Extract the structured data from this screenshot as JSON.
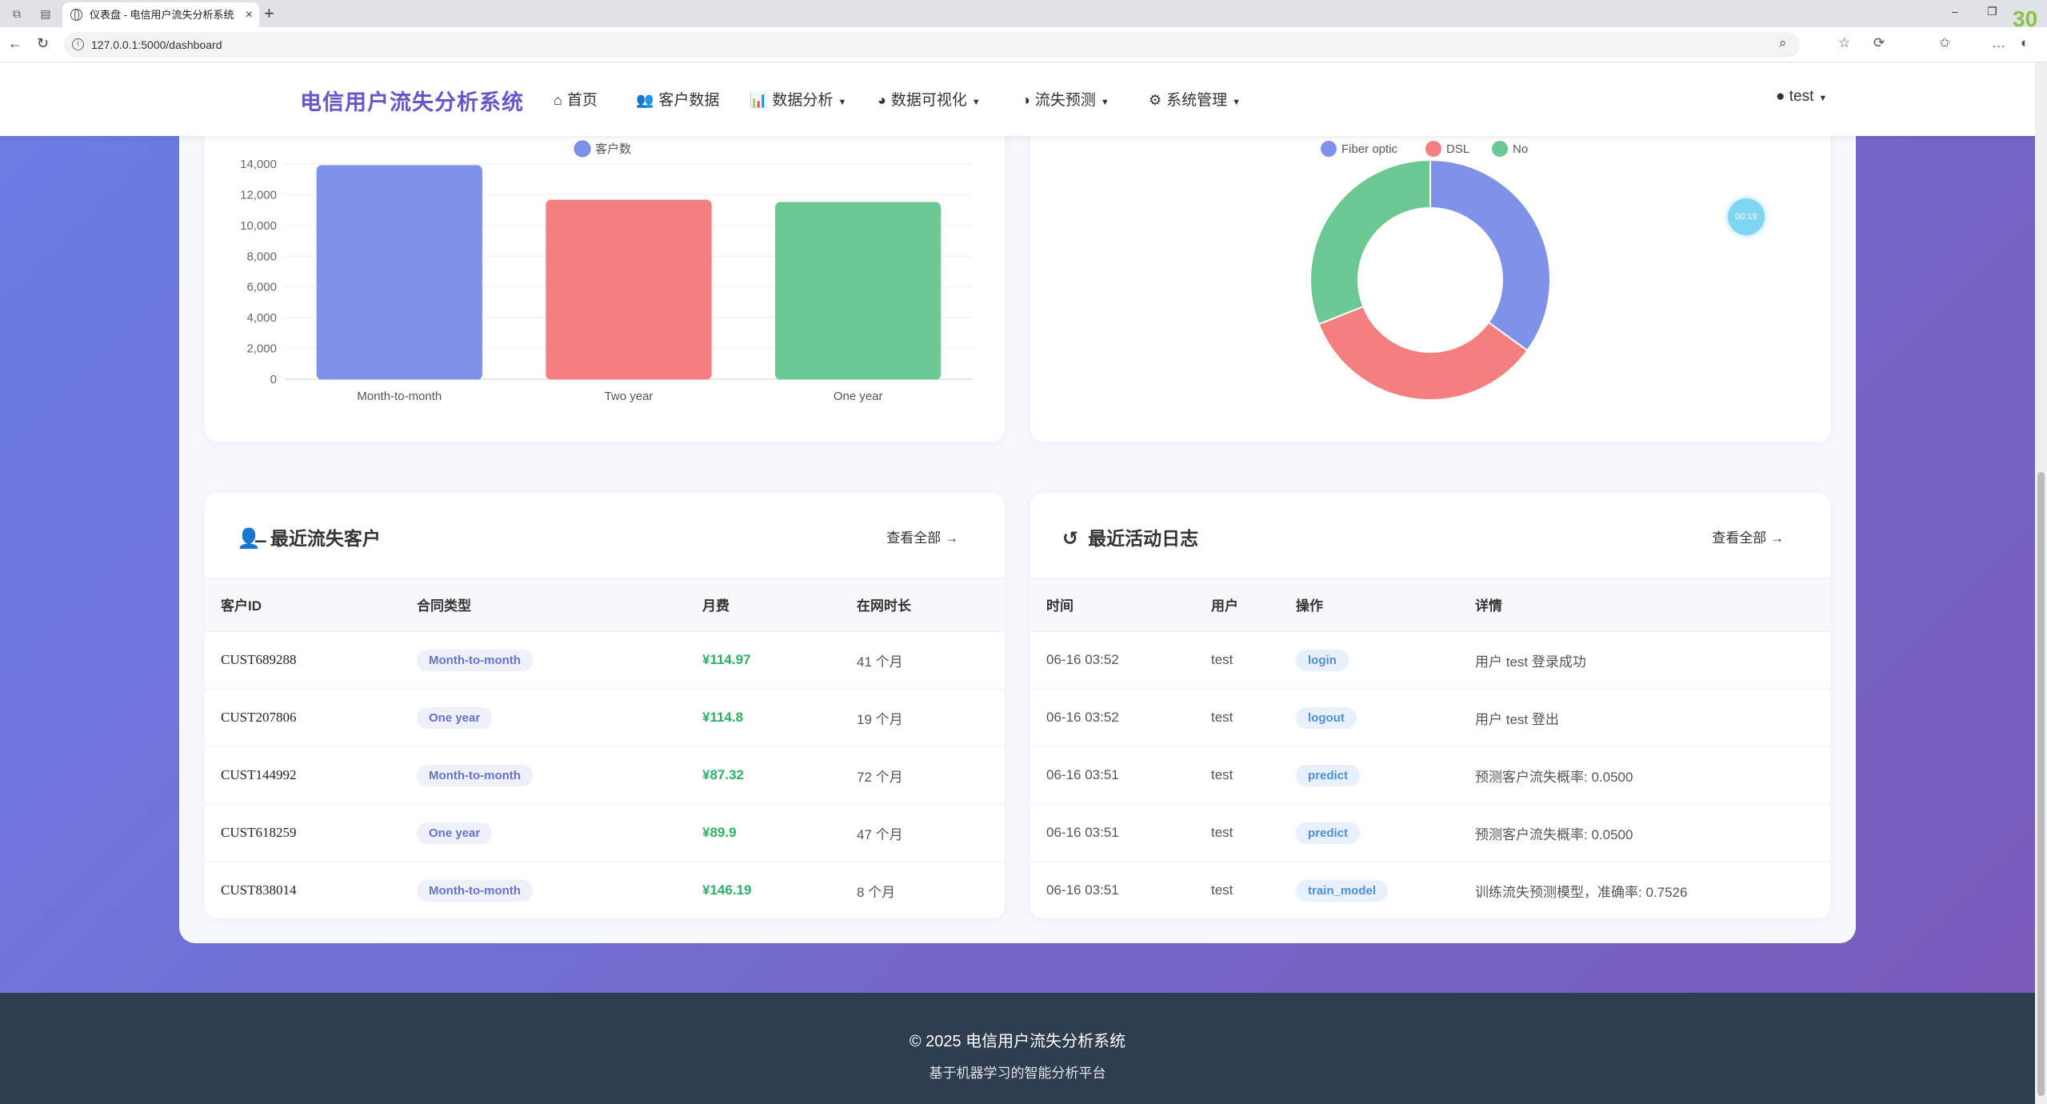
{
  "browser": {
    "tab_title": "仪表盘 - 电信用户流失分析系统",
    "url": "127.0.0.1:5000/dashboard",
    "corner_badge": "30"
  },
  "nav": {
    "brand": "电信用户流失分析系统",
    "items": [
      {
        "label": "首页",
        "icon": "home-icon"
      },
      {
        "label": "客户数据",
        "icon": "users-icon"
      },
      {
        "label": "数据分析",
        "icon": "chart-bar-icon"
      },
      {
        "label": "数据可视化",
        "icon": "pie-chart-icon"
      },
      {
        "label": "流失预测",
        "icon": "brain-icon"
      },
      {
        "label": "系统管理",
        "icon": "gear-icon"
      }
    ],
    "user": "test"
  },
  "timer": "00:19",
  "bar_chart": {
    "chart_data": {
      "type": "bar",
      "categories": [
        "Month-to-month",
        "Two year",
        "One year"
      ],
      "series": [
        {
          "name": "客户数",
          "values": [
            13900,
            11650,
            11500
          ]
        }
      ],
      "yticks": [
        "0",
        "2,000",
        "4,000",
        "6,000",
        "8,000",
        "10,000",
        "12,000",
        "14,000"
      ],
      "ylim": [
        0,
        14000
      ],
      "colors": [
        "#7f92e8",
        "#f47f7f",
        "#6cc893"
      ],
      "legend_position": "top-center"
    }
  },
  "donut_chart": {
    "chart_data": {
      "type": "pie",
      "labels": [
        "Fiber optic",
        "DSL",
        "No"
      ],
      "values": [
        35,
        34,
        31
      ],
      "colors": [
        "#7f92e8",
        "#f47f7f",
        "#6cc893"
      ],
      "legend_position": "top-center"
    }
  },
  "churn_card": {
    "title": "最近流失客户",
    "view_all": "查看全部",
    "columns": [
      "客户ID",
      "合同类型",
      "月费",
      "在网时长"
    ],
    "rows": [
      {
        "id": "CUST689288",
        "contract": "Month-to-month",
        "fee": "¥114.97",
        "tenure": "41 个月"
      },
      {
        "id": "CUST207806",
        "contract": "One year",
        "fee": "¥114.8",
        "tenure": "19 个月"
      },
      {
        "id": "CUST144992",
        "contract": "Month-to-month",
        "fee": "¥87.32",
        "tenure": "72 个月"
      },
      {
        "id": "CUST618259",
        "contract": "One year",
        "fee": "¥89.9",
        "tenure": "47 个月"
      },
      {
        "id": "CUST838014",
        "contract": "Month-to-month",
        "fee": "¥146.19",
        "tenure": "8 个月"
      }
    ]
  },
  "activity_card": {
    "title": "最近活动日志",
    "view_all": "查看全部",
    "columns": [
      "时间",
      "用户",
      "操作",
      "详情"
    ],
    "rows": [
      {
        "time": "06-16 03:52",
        "user": "test",
        "action": "login",
        "detail": "用户 test 登录成功"
      },
      {
        "time": "06-16 03:52",
        "user": "test",
        "action": "logout",
        "detail": "用户 test 登出"
      },
      {
        "time": "06-16 03:51",
        "user": "test",
        "action": "predict",
        "detail": "预测客户流失概率: 0.0500"
      },
      {
        "time": "06-16 03:51",
        "user": "test",
        "action": "predict",
        "detail": "预测客户流失概率: 0.0500"
      },
      {
        "time": "06-16 03:51",
        "user": "test",
        "action": "train_model",
        "detail": "训练流失预测模型，准确率: 0.7526"
      }
    ]
  },
  "footer": {
    "copyright": "© 2025 电信用户流失分析系统",
    "tagline": "基于机器学习的智能分析平台"
  }
}
